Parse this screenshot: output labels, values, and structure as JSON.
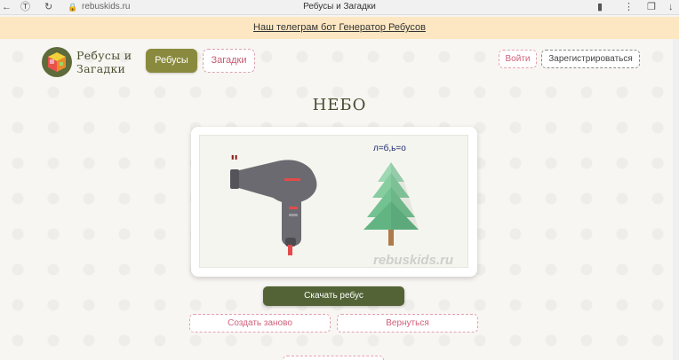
{
  "browser": {
    "url": "rebuskids.ru",
    "tab_title": "Ребусы и Загадки"
  },
  "banner": {
    "text": "Наш телеграм бот Генератор Ребусов"
  },
  "header": {
    "logo_line1": "Ребусы и",
    "logo_line2": "Загадки",
    "nav": {
      "rebusy": "Ребусы",
      "zagadki": "Загадки"
    },
    "login": "Войти",
    "register": "Зарегистрироваться"
  },
  "puzzle": {
    "title": "НЕБО",
    "hint": "л=б,ь=о",
    "apostrophe": "\"",
    "watermark": "rebuskids.ru",
    "images": [
      "hair-dryer",
      "fir-tree"
    ]
  },
  "actions": {
    "download": "Скачать ребус",
    "again": "Создать заново",
    "back": "Вернуться"
  },
  "colors": {
    "banner_bg": "#fce7c2",
    "olive": "#8a8a3e",
    "dark_green": "#536336",
    "pink": "#d1607a"
  }
}
